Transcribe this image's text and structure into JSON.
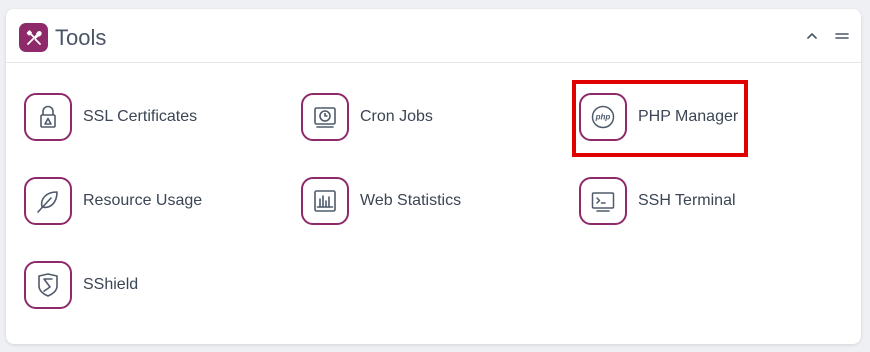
{
  "panel": {
    "title": "Tools",
    "logo_icon": "tools-icon",
    "controls": [
      "chevron-up-icon",
      "menu-icon"
    ],
    "accent_color": "#8e2a6a",
    "highlight_color": "#e00000"
  },
  "tools": [
    {
      "label": "SSL Certificates",
      "icon": "lock-icon"
    },
    {
      "label": "Cron Jobs",
      "icon": "clock-icon"
    },
    {
      "label": "PHP Manager",
      "icon": "php-icon",
      "highlighted": true
    },
    {
      "label": "Resource Usage",
      "icon": "leaf-icon"
    },
    {
      "label": "Web Statistics",
      "icon": "bar-chart-icon"
    },
    {
      "label": "SSH Terminal",
      "icon": "terminal-icon"
    },
    {
      "label": "SShield",
      "icon": "shield-icon"
    }
  ]
}
